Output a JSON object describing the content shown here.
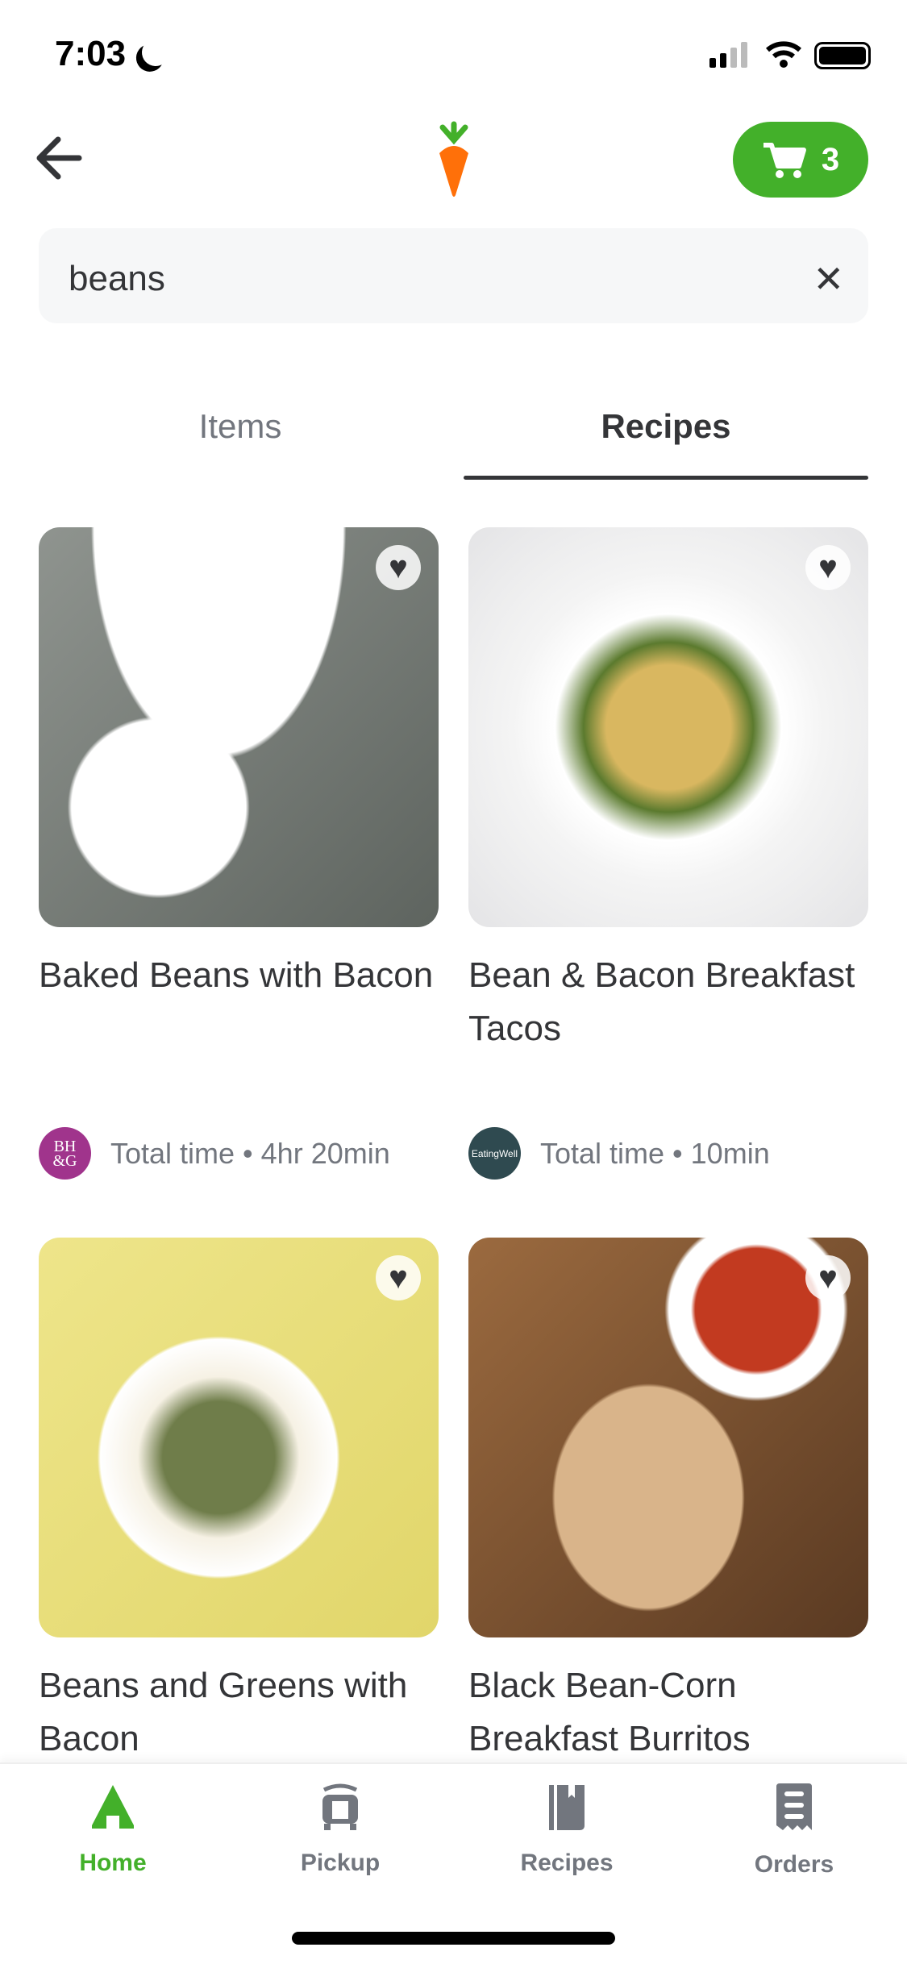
{
  "status_bar": {
    "time": "7:03"
  },
  "header": {
    "back_icon": "arrow-left-icon",
    "logo_icon": "carrot-icon",
    "cart_count": "3",
    "accent": "#43b02a"
  },
  "search": {
    "value": "beans",
    "clear_icon": "x-icon"
  },
  "tabs": [
    {
      "label": "Items",
      "active": false
    },
    {
      "label": "Recipes",
      "active": true
    }
  ],
  "recipes": [
    {
      "title": "Baked Beans with Bacon",
      "source_logo": "BH&G",
      "time": "Total time • 4hr 20min"
    },
    {
      "title": "Bean & Bacon Breakfast Tacos",
      "source_logo": "EatingWell",
      "time": "Total time • 10min"
    },
    {
      "title": "Beans and Greens with Bacon"
    },
    {
      "title": "Black Bean-Corn Breakfast Burritos"
    }
  ],
  "nav": [
    {
      "label": "Home",
      "active": true
    },
    {
      "label": "Pickup"
    },
    {
      "label": "Recipes"
    },
    {
      "label": "Orders"
    }
  ]
}
